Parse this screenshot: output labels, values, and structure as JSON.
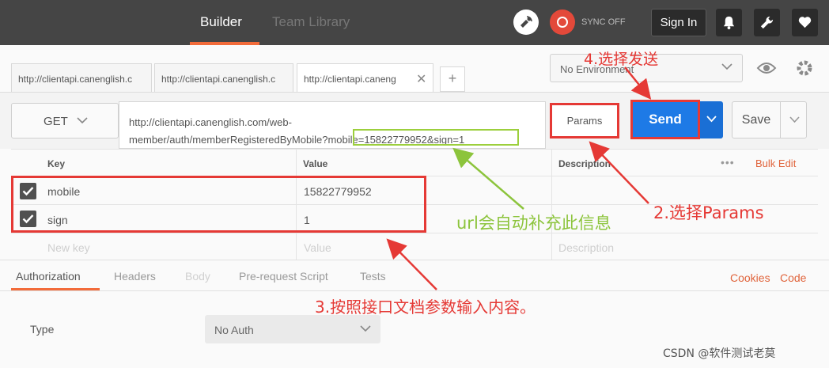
{
  "topbar": {
    "builder_tab": "Builder",
    "team_library_tab": "Team Library",
    "sync_status": "SYNC OFF",
    "sign_in": "Sign In"
  },
  "request_tabs": [
    {
      "label": "http://clientapi.canenglish.c"
    },
    {
      "label": "http://clientapi.canenglish.c"
    },
    {
      "label": "http://clientapi.caneng"
    }
  ],
  "new_tab_label": "+",
  "environment": {
    "selected": "No Environment"
  },
  "request": {
    "method": "GET",
    "url_line1": "http://clientapi.canenglish.com/web-",
    "url_line2": "member/auth/memberRegisteredByMobile",
    "url_query": "?mobile=15822779952&sign=1",
    "params_button": "Params",
    "send_button": "Send",
    "save_button": "Save"
  },
  "params_table": {
    "headers": {
      "key": "Key",
      "value": "Value",
      "description": "Description"
    },
    "more": "•••",
    "bulk_edit": "Bulk Edit",
    "rows": [
      {
        "checked": true,
        "key": "mobile",
        "value": "15822779952"
      },
      {
        "checked": true,
        "key": "sign",
        "value": "1"
      }
    ],
    "placeholders": {
      "key": "New key",
      "value": "Value",
      "description": "Description"
    }
  },
  "subtabs": {
    "authorization": "Authorization",
    "headers": "Headers",
    "body": "Body",
    "prerequest": "Pre-request Script",
    "tests": "Tests",
    "cookies": "Cookies",
    "code": "Code"
  },
  "auth": {
    "type_label": "Type",
    "selected": "No Auth"
  },
  "annotations": {
    "step4": "4.选择发送",
    "step2": "2.选择Params",
    "url_note": "url会自动补充此信息",
    "step3": "3.按照接口文档参数输入内容。"
  },
  "watermark": "CSDN @软件测试老莫",
  "colors": {
    "topbar": "#454545",
    "accent_orange": "#f26b3a",
    "send_blue": "#1e7ae6",
    "annotation_red": "#e53935",
    "annotation_green": "#8cc43c"
  },
  "icons": [
    "satellite-icon",
    "sync-icon",
    "bell-icon",
    "wrench-icon",
    "heart-icon",
    "close-icon",
    "eye-icon",
    "gear-icon",
    "chevron-down-icon",
    "checkmark-icon"
  ]
}
